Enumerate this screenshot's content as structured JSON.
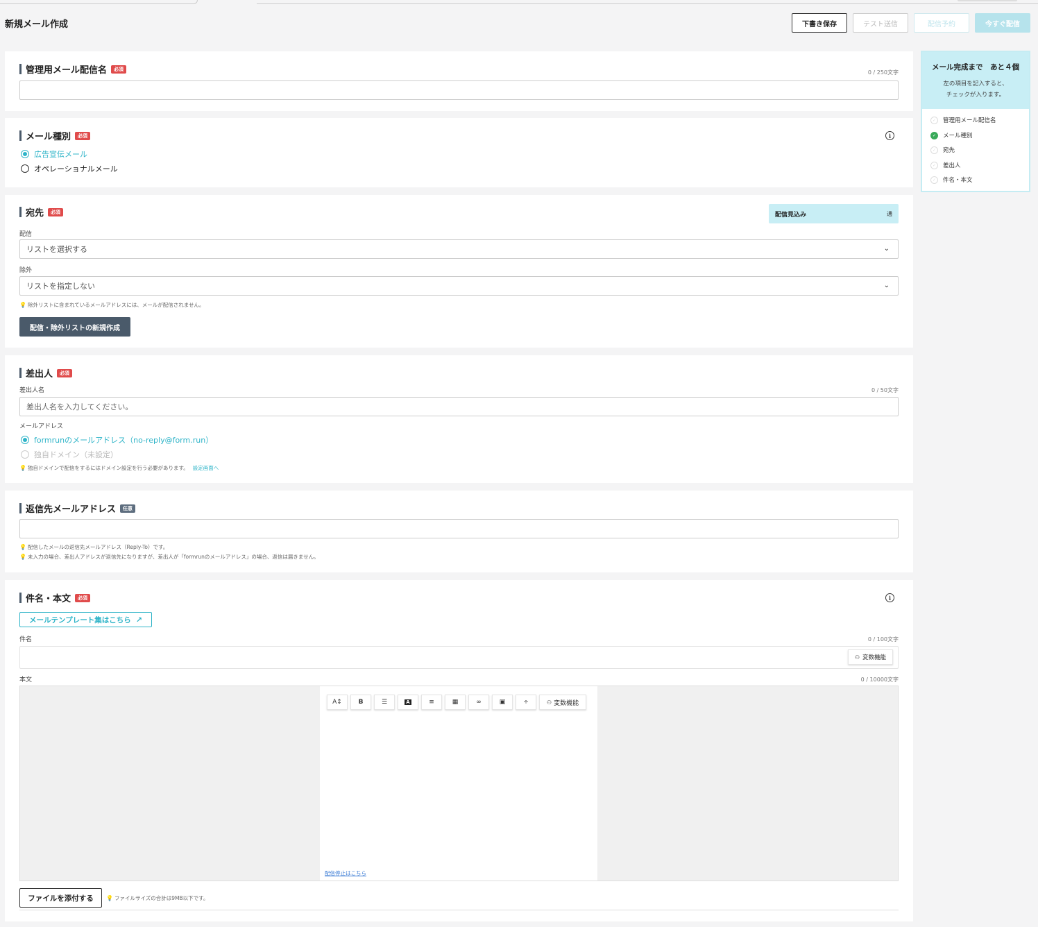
{
  "header": {
    "title": "新規メール作成",
    "draft_label": "下書き保存",
    "test_label": "テスト送信",
    "reserve_label": "配信予約",
    "send_now_label": "今すぐ配信"
  },
  "badges": {
    "required": "必須",
    "optional": "任意"
  },
  "section_name": {
    "title": "管理用メール配信名",
    "counter": "0 / 250文字",
    "value": ""
  },
  "section_type": {
    "title": "メール種別",
    "options": [
      "広告宣伝メール",
      "オペレーショナルメール"
    ],
    "selected": "広告宣伝メール"
  },
  "section_dest": {
    "title": "宛先",
    "estimate_label": "配信見込み",
    "estimate_unit": "通",
    "deliver_label": "配信",
    "deliver_value": "リストを選択する",
    "exclude_label": "除外",
    "exclude_value": "リストを指定しない",
    "hint": "除外リストに含まれているメールアドレスには、メールが配信されません。",
    "create_button": "配信・除外リストの新規作成"
  },
  "section_sender": {
    "title": "差出人",
    "name_label": "差出人名",
    "counter": "0 / 50文字",
    "name_placeholder": "差出人名を入力してください。",
    "email_label": "メールアドレス",
    "options": [
      "formrunのメールアドレス（no-reply@form.run）",
      "独自ドメイン（未設定）"
    ],
    "selected": "formrunのメールアドレス（no-reply@form.run）",
    "hint": "独自ドメインで配信をするにはドメイン設定を行う必要があります。",
    "hint_link": "設定画面へ"
  },
  "section_reply": {
    "title": "返信先メールアドレス",
    "value": "",
    "hint1": "配信したメールの返信先メールアドレス（Reply-To）です。",
    "hint2": "未入力の場合、差出人アドレスが返信先になりますが、差出人が「formrunのメールアドレス」の場合、返信は届きません。"
  },
  "section_body": {
    "title": "件名・本文",
    "template_button": "メールテンプレート集はこちら",
    "subject_label": "件名",
    "subject_counter": "0 / 100文字",
    "variable_label": "変数機能",
    "body_label": "本文",
    "body_counter": "0 / 10000文字",
    "unsubscribe_link": "配信停止はこちら",
    "attach_button": "ファイルを添付する",
    "attach_hint": "ファイルサイズの合計は9MB以下です。",
    "toolbar": [
      "font-size-icon",
      "bold-icon",
      "list-icon",
      "text-color-icon",
      "align-icon",
      "table-icon",
      "link-icon",
      "image-icon",
      "divider-icon"
    ]
  },
  "sidebar": {
    "title": "メール完成まで　あと４個",
    "subtitle_line1": "左の項目を記入すると、",
    "subtitle_line2": "チェックが入ります。",
    "items": [
      {
        "label": "管理用メール配信名",
        "done": false
      },
      {
        "label": "メール種別",
        "done": true
      },
      {
        "label": "宛先",
        "done": false
      },
      {
        "label": "差出人",
        "done": false
      },
      {
        "label": "件名・本文",
        "done": false
      }
    ]
  },
  "colors": {
    "accent": "#2fb4c8",
    "required": "#e04b4b",
    "dark_button": "#4a5a6a",
    "sidebar_head": "#c8eef5"
  }
}
